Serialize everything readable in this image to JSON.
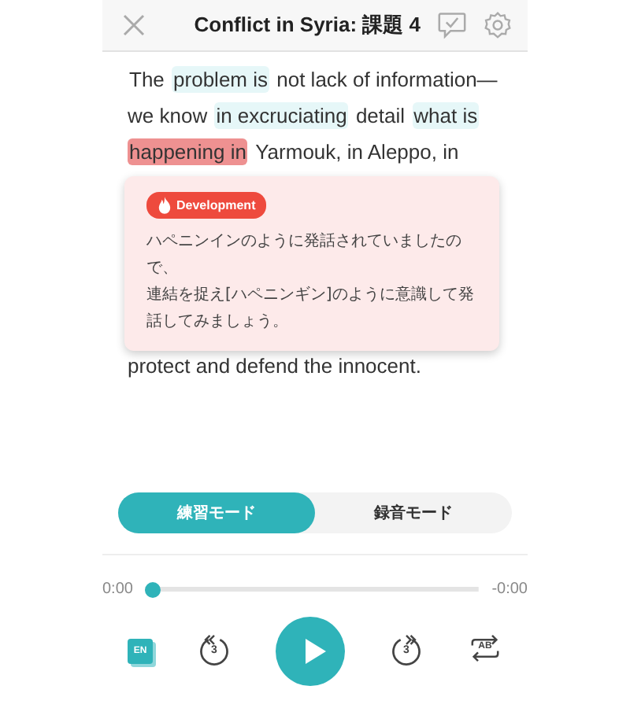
{
  "header": {
    "title": "Conflict in Syria: 課題 4"
  },
  "passage": {
    "segments": [
      {
        "text": "The",
        "kind": "plain"
      },
      {
        "text": "problem is",
        "kind": "phrase"
      },
      {
        "text": "not lack of information—we know",
        "kind": "plain"
      },
      {
        "text": "in excruciating",
        "kind": "phrase"
      },
      {
        "text": "detail",
        "kind": "plain"
      },
      {
        "text": "what is",
        "kind": "phrase"
      },
      {
        "text": "happening in",
        "kind": "error"
      },
      {
        "text": "Yarmouk, in Aleppo, in",
        "kind": "plain"
      }
    ],
    "after": "protect and defend the innocent."
  },
  "popup": {
    "badge": "Development",
    "lines": [
      "ハペニンインのように発話されていましたので、",
      "連結を捉え[ハペニンギン]のように意識して発話してみましょう。"
    ]
  },
  "modes": [
    {
      "label": "練習モード",
      "selected": true
    },
    {
      "label": "録音モード",
      "selected": false
    }
  ],
  "player": {
    "elapsed": "0:00",
    "remaining": "-0:00",
    "level": 0,
    "language": "EN",
    "back_seconds": "3",
    "forward_seconds": "3",
    "repeat": "AB"
  }
}
